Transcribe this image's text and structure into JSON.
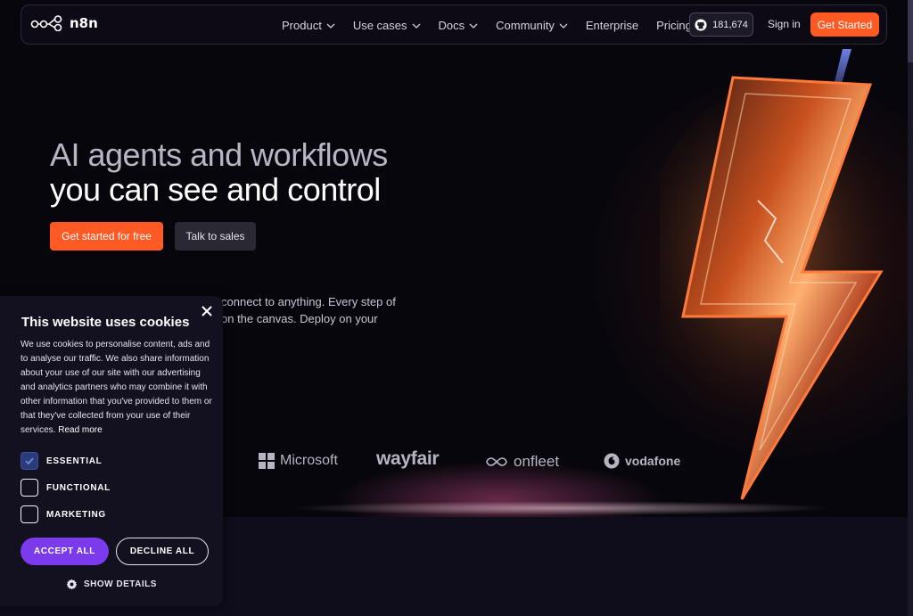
{
  "nav": {
    "logo_text": "n8n",
    "items": [
      {
        "label": "Product",
        "dropdown": true
      },
      {
        "label": "Use cases",
        "dropdown": true
      },
      {
        "label": "Docs",
        "dropdown": true
      },
      {
        "label": "Community",
        "dropdown": true
      },
      {
        "label": "Enterprise",
        "dropdown": false
      },
      {
        "label": "Pricing",
        "dropdown": false
      }
    ],
    "github_stars": "181,674",
    "sign_in": "Sign in",
    "get_started": "Get Started"
  },
  "hero": {
    "title_line1": "AI agents and workflows",
    "title_line2": "you can see and control",
    "cta_primary": "Get started for free",
    "cta_secondary": "Talk to sales",
    "description_line1": "connect to anything. Every step of",
    "description_line2": "on the canvas. Deploy on your"
  },
  "logos": [
    "Microsoft",
    "wayfair",
    "onfleet",
    "vodafone"
  ],
  "cookie": {
    "title": "This website uses cookies",
    "body": "We use cookies to personalise content, ads and to analyse our traffic. We also share information about your use of our site with our advertising and analytics partners who may combine it with other information that you've provided to them or that they've collected from your use of their services.",
    "read_more": "Read more",
    "options": [
      {
        "label": "ESSENTIAL",
        "checked": true
      },
      {
        "label": "FUNCTIONAL",
        "checked": false
      },
      {
        "label": "MARKETING",
        "checked": false
      }
    ],
    "accept_all": "ACCEPT ALL",
    "decline_all": "DECLINE ALL",
    "show_details": "SHOW DETAILS"
  },
  "colors": {
    "accent_orange": "#ff5a23",
    "accept_purple": "#7c3aed",
    "background": "#0e0b18"
  }
}
